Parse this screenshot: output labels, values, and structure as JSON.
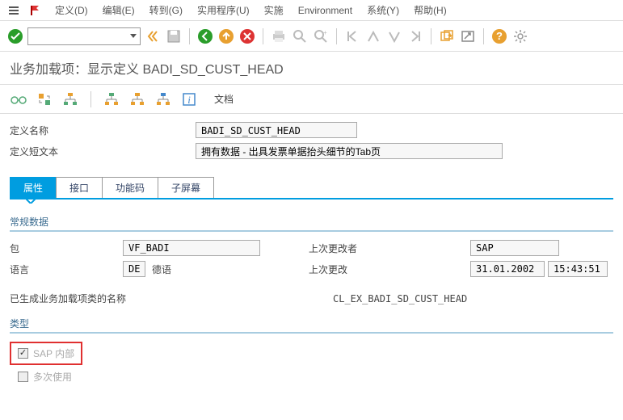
{
  "menubar": {
    "items": [
      "定义(D)",
      "编辑(E)",
      "转到(G)",
      "实用程序(U)",
      "实施",
      "Environment",
      "系统(Y)",
      "帮助(H)"
    ]
  },
  "page_title": "业务加载项：显示定义 BADI_SD_CUST_HEAD",
  "secondary": {
    "doc_label": "文档"
  },
  "form": {
    "def_name_label": "定义名称",
    "def_name_value": "BADI_SD_CUST_HEAD",
    "def_short_label": "定义短文本",
    "def_short_value": "拥有数据 - 出具发票单据抬头细节的Tab页"
  },
  "tabs": [
    "属性",
    "接口",
    "功能码",
    "子屏幕"
  ],
  "general": {
    "title": "常规数据",
    "pkg_label": "包",
    "pkg_value": "VF_BADI",
    "lang_label": "语言",
    "lang_code": "DE",
    "lang_name": "德语",
    "changed_by_label": "上次更改者",
    "changed_by_value": "SAP",
    "changed_on_label": "上次更改",
    "changed_on_date": "31.01.2002",
    "changed_on_time": "15:43:51",
    "gen_class_label": "已生成业务加载项类的名称",
    "gen_class_value": "CL_EX_BADI_SD_CUST_HEAD"
  },
  "type": {
    "title": "类型",
    "sap_internal_label": "SAP 内部",
    "multi_use_label": "多次使用"
  }
}
